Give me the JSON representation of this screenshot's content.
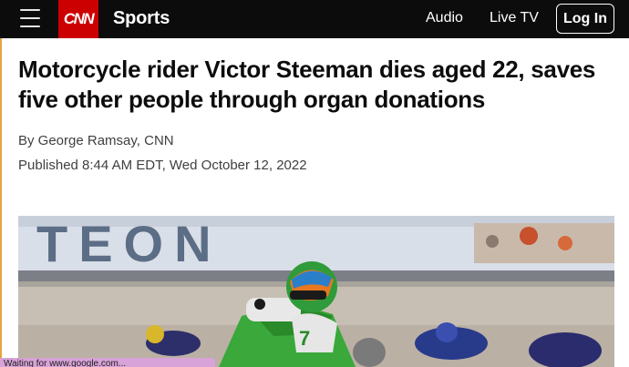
{
  "header": {
    "logo_text": "CNN",
    "section": "Sports",
    "nav": [
      {
        "label": "Audio"
      },
      {
        "label": "Live TV"
      }
    ],
    "login_label": "Log In"
  },
  "article": {
    "headline": "Motorcycle rider Victor Steeman dies aged 22, saves five other people through organ donations",
    "byline": "By George Ramsay, CNN",
    "published": "Published 8:44 AM EDT, Wed October 12, 2022",
    "hero_banner_text": "TEON"
  },
  "status_bar": {
    "text": "Waiting for www.google.com..."
  },
  "colors": {
    "header_bg": "#0c0c0c",
    "brand_red": "#cc0000",
    "rider_green": "#3aa83a"
  }
}
